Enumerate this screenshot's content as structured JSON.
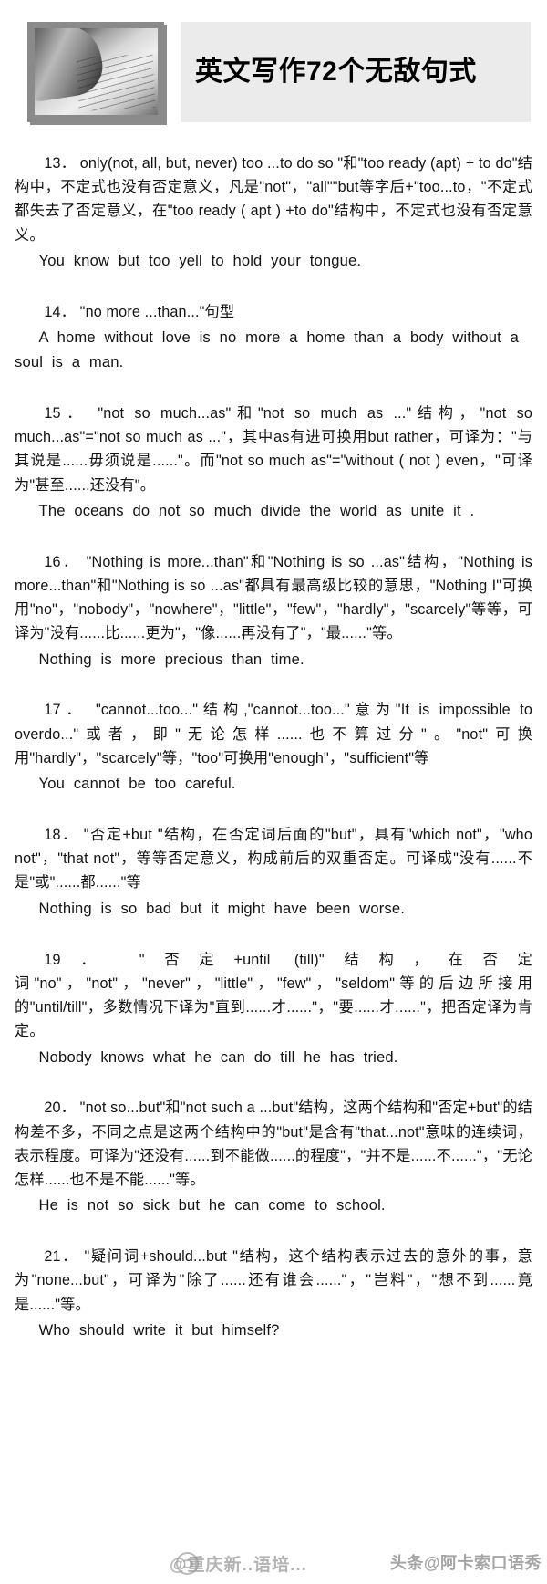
{
  "header": {
    "thumbnail_alt": "handwriting-photo",
    "title": "英文写作72个无敌句式"
  },
  "article": {
    "entries": [
      {
        "number": "13",
        "note": "13． only(not, all, but, never) too ...to do so \"和\"too ready (apt) + to do\"结构中，不定式也没有否定意义，凡是\"not\"，\"all\"\"but等字后+\"too...to，\"不定式都失去了否定意义，在\"too ready ( apt ) +to do\"结构中，不定式也没有否定意义。",
        "example": "You know but too yell to hold your tongue."
      },
      {
        "number": "14",
        "note": "14． \"no more ...than...\"句型",
        "example": "A home without love is no more a home than a body without a soul is a man."
      },
      {
        "number": "15",
        "note": "15． \"not so much...as\"和\"not so much as ...\"结构，\"not so much...as\"=\"not so much as ...\"，其中as有进可换用but rather，可译为：\"与其说是......毋须说是......\"。而\"not so much as\"=\"without ( not ) even，\"可译为\"甚至......还没有\"。",
        "example": "The oceans do not so much divide the world as unite it ."
      },
      {
        "number": "16",
        "note": "16． \"Nothing is more...than\"和\"Nothing is so ...as\"结构，\"Nothing is more...than\"和\"Nothing is so ...as\"都具有最高级比较的意思，\"Nothing I\"可换用\"no\"，\"nobody\"，\"nowhere\"，\"little\"，\"few\"，\"hardly\"，\"scarcely\"等等，可译为\"没有......比......更为\"，\"像......再没有了\"，\"最......\"等。",
        "example": "Nothing is more precious than time."
      },
      {
        "number": "17",
        "note": "17． \"cannot...too...\"结构,\"cannot...too...\"意为\"It is impossible to overdo...\"或者，即\"无论怎样......也不算过分\"。\"not\"可换用\"hardly\"，\"scarcely\"等，\"too\"可换用\"enough\"，\"sufficient\"等",
        "example": "You cannot be too careful."
      },
      {
        "number": "18",
        "note": "18． \"否定+but \"结构，在否定词后面的\"but\"，具有\"which not\"，\"who not\"，\"that not\"，等等否定意义，构成前后的双重否定。可译成\"没有......不是\"或\"......都......\"等",
        "example": "Nothing is so bad but it might have been worse."
      },
      {
        "number": "19",
        "note": "19． \"否定+until (till)\"结构，在否定词\"no\"，\"not\"，\"never\"，\"little\"，\"few\"，\"seldom\"等的后边所接用的\"until/till\"，多数情况下译为\"直到......才......\"，\"要......才......\"，把否定译为肯定。",
        "example": "Nobody knows what he can do till he has tried."
      },
      {
        "number": "20",
        "note": "20． \"not so...but\"和\"not such a ...but\"结构，这两个结构和\"否定+but\"的结构差不多，不同之点是这两个结构中的\"but\"是含有\"that...not\"意味的连续词，表示程度。可译为\"还没有......到不能做......的程度\"，\"并不是......不......\"，\"无论怎样......也不是不能......\"等。",
        "example": "He is not so sick but he can come to school."
      },
      {
        "number": "21",
        "note": "21． \"疑问词+should...but \"结构，这个结构表示过去的意外的事，意为\"none...but\"，可译为\"除了......还有谁会......\"，\"岂料\"，\"想不到......竟是......\"等。",
        "example": "Who should write it but himself?"
      }
    ]
  },
  "watermarks": {
    "center": "@重庆新..语培...",
    "right": "头条@阿卡索口语秀"
  }
}
